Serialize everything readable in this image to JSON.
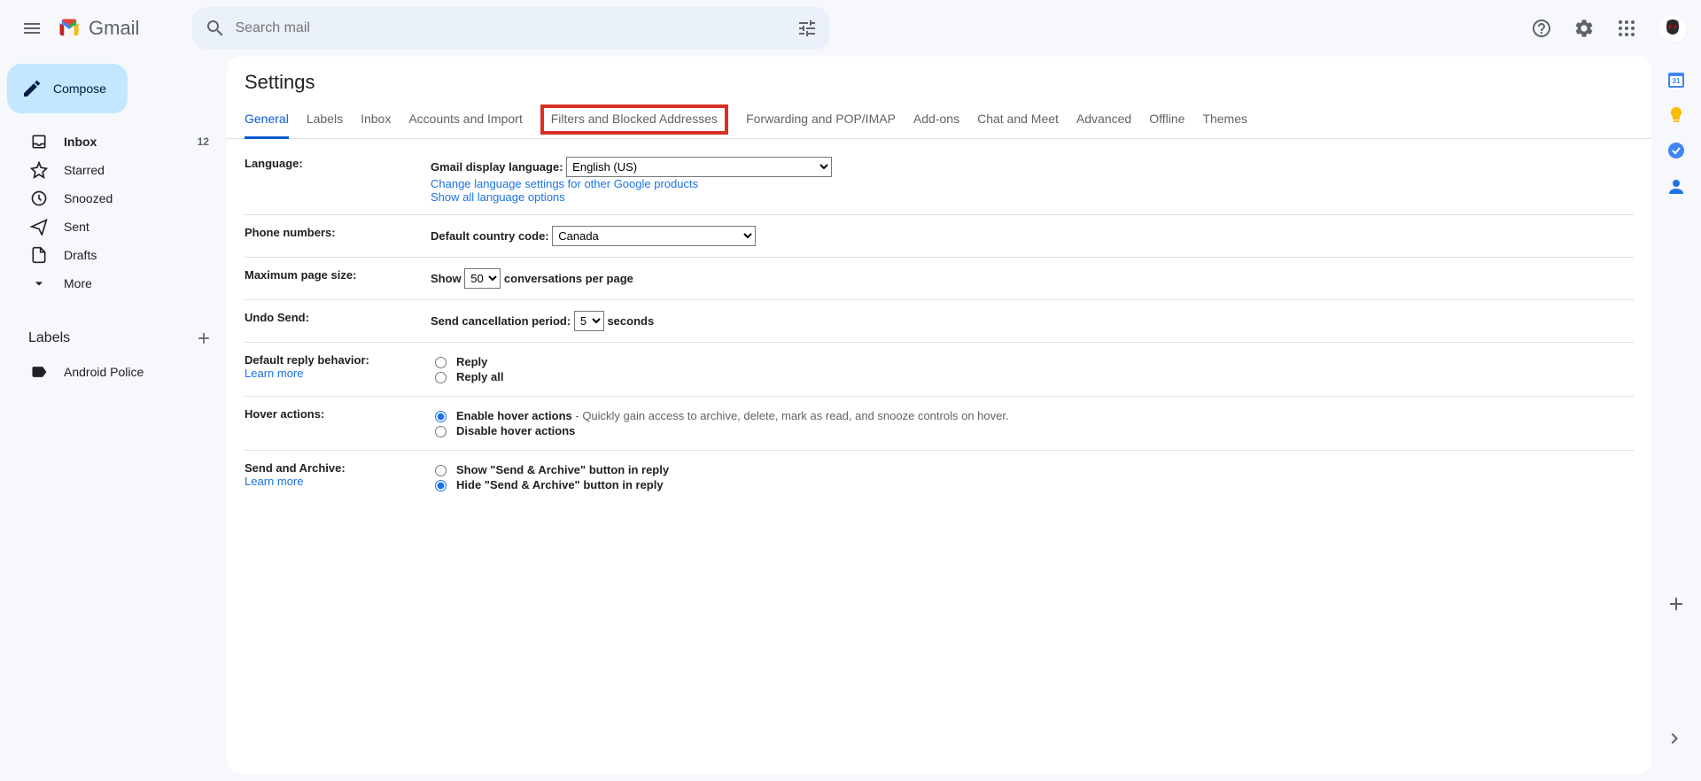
{
  "header": {
    "product": "Gmail",
    "search_placeholder": "Search mail"
  },
  "sidebar": {
    "compose": "Compose",
    "items": [
      {
        "icon": "inbox",
        "label": "Inbox",
        "count": "12",
        "active": true
      },
      {
        "icon": "star",
        "label": "Starred"
      },
      {
        "icon": "clock",
        "label": "Snoozed"
      },
      {
        "icon": "sent",
        "label": "Sent"
      },
      {
        "icon": "draft",
        "label": "Drafts"
      },
      {
        "icon": "more",
        "label": "More"
      }
    ],
    "labels_header": "Labels",
    "labels": [
      {
        "label": "Android Police"
      }
    ]
  },
  "settings": {
    "title": "Settings",
    "tabs": [
      "General",
      "Labels",
      "Inbox",
      "Accounts and Import",
      "Filters and Blocked Addresses",
      "Forwarding and POP/IMAP",
      "Add-ons",
      "Chat and Meet",
      "Advanced",
      "Offline",
      "Themes"
    ],
    "language": {
      "label": "Language:",
      "display_label": "Gmail display language:",
      "value": "English (US)",
      "change_link": "Change language settings for other Google products",
      "show_all_link": "Show all language options"
    },
    "phone": {
      "label": "Phone numbers:",
      "code_label": "Default country code:",
      "value": "Canada"
    },
    "page_size": {
      "label": "Maximum page size:",
      "show": "Show",
      "value": "50",
      "suffix": "conversations per page"
    },
    "undo": {
      "label": "Undo Send:",
      "period_label": "Send cancellation period:",
      "value": "5",
      "suffix": "seconds"
    },
    "reply": {
      "label": "Default reply behavior:",
      "learn": "Learn more",
      "opt1": "Reply",
      "opt2": "Reply all"
    },
    "hover": {
      "label": "Hover actions:",
      "opt1": "Enable hover actions",
      "opt1_hint": " - Quickly gain access to archive, delete, mark as read, and snooze controls on hover.",
      "opt2": "Disable hover actions"
    },
    "send_archive": {
      "label": "Send and Archive:",
      "learn": "Learn more",
      "opt1": "Show \"Send & Archive\" button in reply",
      "opt2": "Hide \"Send & Archive\" button in reply"
    }
  }
}
